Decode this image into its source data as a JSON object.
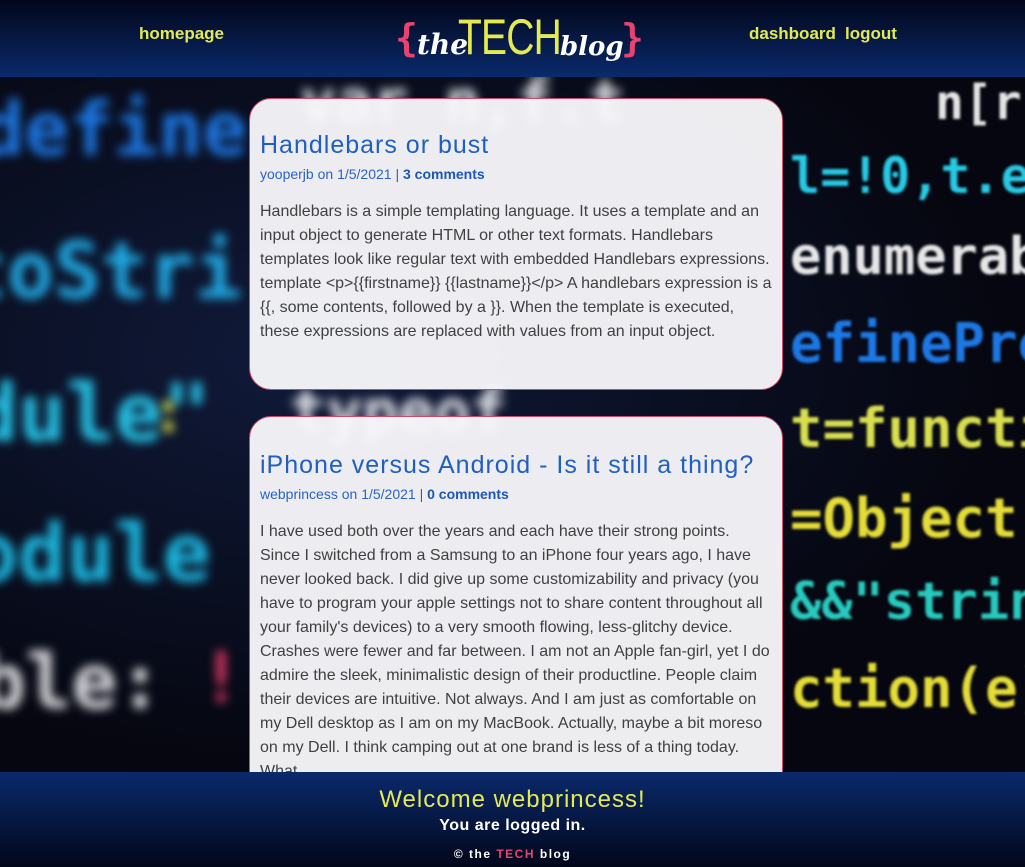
{
  "header": {
    "home_link": "homepage",
    "dashboard_link": "dashboard",
    "logout_link": "logout",
    "logo": {
      "open_brace": "{",
      "the": "the",
      "tech": "TECH",
      "blog": "blog",
      "close_brace": "}"
    }
  },
  "posts": [
    {
      "title": "Handlebars or bust",
      "author": "yooperjb",
      "date": "1/5/2021",
      "comments_label": "3 comments",
      "body": "Handlebars is a simple templating language. It uses a template and an input object to generate HTML or other text formats. Handlebars templates look like regular text with embedded Handlebars expressions. template <p>{{firstname}} {{lastname}}</p> A handlebars expression is a {{, some contents, followed by a }}. When the template is executed, these expressions are replaced with values from an input object."
    },
    {
      "title": "iPhone versus Android - Is it still a thing?",
      "author": "webprincess",
      "date": "1/5/2021",
      "comments_label": "0 comments",
      "body": "I have used both over the years and each have their strong points. Since I switched from a Samsung to an iPhone four years ago, I have never looked back. I did give up some customizability and privacy (you have to program your apple settings not to share content throughout all your family's devices) to a very smooth flowing, less-glitchy device. Crashes were fewer and far between. I am not an Apple fan-girl, yet I do admire the sleek, minimalistic design of their productline. People claim their devices are intuitive. Not always. And I am just as comfortable on my Dell desktop as I am on my MacBook. Actually, maybe a bit moreso on my Dell. I think camping out at one brand is less of a thing today. What"
    }
  ],
  "footer": {
    "welcome": "Welcome webprincess!",
    "status": "You are logged in.",
    "copyright_prefix": "© the",
    "copyright_accent": "TECH",
    "copyright_suffix": "blog"
  },
  "colors": {
    "accent_yellow": "#e4ea52",
    "accent_pink": "#e8436e",
    "link_blue": "#1f5fbf",
    "header_blue": "#0a2a6c"
  }
}
